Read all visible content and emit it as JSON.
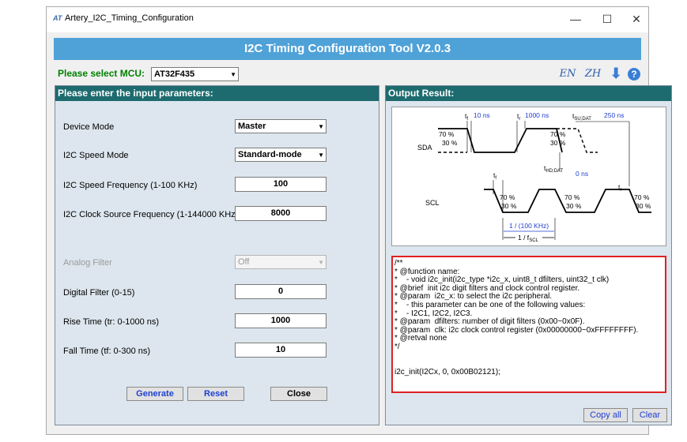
{
  "window": {
    "title": "Artery_I2C_Timing_Configuration",
    "app_icon": "AT",
    "minimize": "—",
    "maximize": "☐",
    "close": "✕"
  },
  "header": {
    "title": "I2C Timing Configuration Tool V2.0.3"
  },
  "mcu": {
    "label": "Please select MCU:",
    "selected": "AT32F435"
  },
  "toolbar": {
    "lang_en": "EN",
    "lang_zh": "ZH",
    "download_icon": "down-arrow-icon",
    "help_icon": "?"
  },
  "input_panel": {
    "title": "Please enter the input parameters:",
    "device_mode": {
      "label": "Device Mode",
      "value": "Master"
    },
    "speed_mode": {
      "label": "I2C Speed Mode",
      "value": "Standard-mode"
    },
    "speed_freq": {
      "label": "I2C Speed Frequency (1-100 KHz)",
      "value": "100"
    },
    "clock_freq": {
      "label": "I2C Clock Source Frequency (1-144000 KHz)",
      "value": "8000"
    },
    "analog_filter": {
      "label": "Analog Filter",
      "value": "Off"
    },
    "digital_filter": {
      "label": "Digital Filter (0-15)",
      "value": "0"
    },
    "rise_time": {
      "label": "Rise Time (tr: 0-1000 ns)",
      "value": "1000"
    },
    "fall_time": {
      "label": "Fall Time (tf: 0-300 ns)",
      "value": "10"
    },
    "buttons": {
      "generate": "Generate",
      "reset": "Reset",
      "close": "Close"
    }
  },
  "output_panel": {
    "title": "Output Result:",
    "diagram": {
      "sda": "SDA",
      "scl": "SCL",
      "tf_label": "t",
      "tf_sub": "f",
      "tf_value": "10 ns",
      "tr_label": "t",
      "tr_sub": "r",
      "tr_value": "1000 ns",
      "tsu_label": "t",
      "tsu_sub": "SU;DAT",
      "tsu_value": "250 ns",
      "thd_label": "t",
      "thd_sub": "HD;DAT",
      "thd_value": "0 ns",
      "pct70": "70 %",
      "pct30": "30 %",
      "period": "1 / (100 KHz)",
      "period_label": "1 / f",
      "period_sub": "SCL"
    },
    "code": "/**\n* @function name:\n*    - void i2c_init(i2c_type *i2c_x, uint8_t dfilters, uint32_t clk)\n* @brief  init i2c digit filters and clock control register.\n* @param  i2c_x: to select the i2c peripheral.\n*    - this parameter can be one of the following values:\n*    - I2C1, I2C2, I2C3.\n* @param  dfilters: number of digit filters (0x00~0x0F).\n* @param  clk: i2c clock control register (0x00000000~0xFFFFFFFF).\n* @retval none\n*/\n\n\ni2c_init(I2Cx, 0, 0x00B02121);",
    "buttons": {
      "copy_all": "Copy all",
      "clear": "Clear"
    }
  }
}
